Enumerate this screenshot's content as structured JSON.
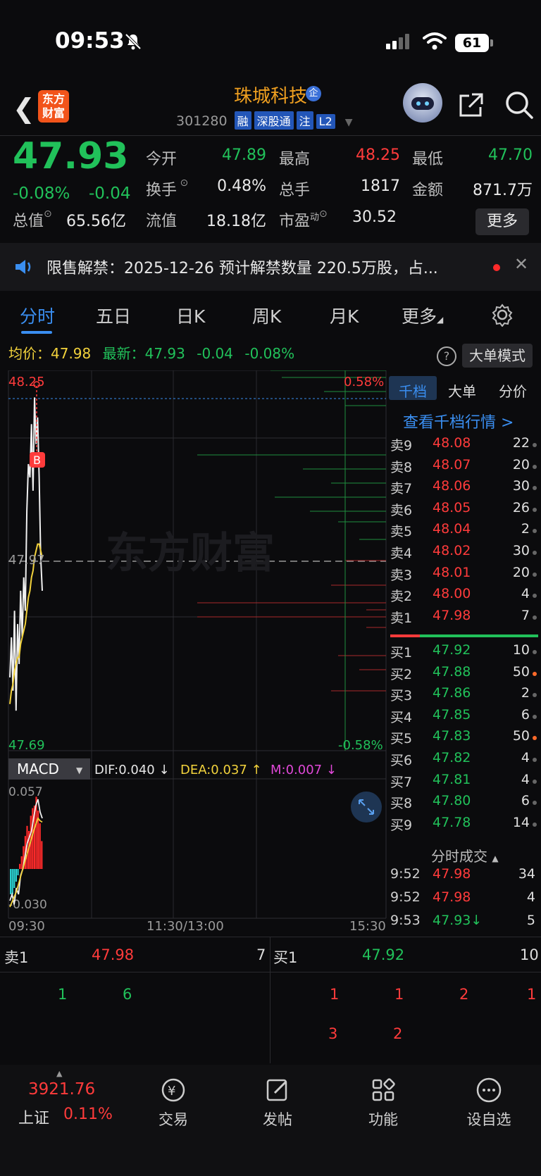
{
  "status_bar": {
    "time": "09:53",
    "battery": "61"
  },
  "header": {
    "logo_line1": "东方",
    "logo_line2": "财富",
    "stock_name": "珠城科技",
    "qi_badge": "企",
    "code": "301280",
    "tags": [
      "融",
      "深股通",
      "注",
      "L2"
    ]
  },
  "quote": {
    "last_price": "47.93",
    "change_pct": "-0.08%",
    "change_abs": "-0.04",
    "open_label": "今开",
    "open": "47.89",
    "high_label": "最高",
    "high": "48.25",
    "low_label": "最低",
    "low": "47.70",
    "turnover_label": "换手",
    "turnover": "0.48%",
    "volume_label": "总手",
    "volume": "1817",
    "amount_label": "金额",
    "amount": "871.7万",
    "mktcap_label": "总值",
    "mktcap": "65.56亿",
    "float_label": "流值",
    "float": "18.18亿",
    "pe_label": "市盈",
    "pe_sup": "动",
    "pe": "30.52",
    "more_label": "更多"
  },
  "notice": {
    "text": "限售解禁：2025-12-26 预计解禁数量 220.5万股，占..."
  },
  "tabs": [
    "分时",
    "五日",
    "日K",
    "周K",
    "月K",
    "更多"
  ],
  "avg_row": {
    "avg_label": "均价：",
    "avg": "47.98",
    "latest_label": "最新：",
    "latest": "47.93",
    "latest_chg": "-0.04",
    "latest_pct": "-0.08%",
    "big_order_label": "大单模式",
    "help": "?"
  },
  "chart_data": {
    "type": "line",
    "y_top_label": "48.25",
    "y_mid_label": "47.97",
    "y_bot_label": "47.69",
    "pct_top_label": "0.58%",
    "pct_bot_label": "-0.58%",
    "x_labels": [
      "09:30",
      "11:30/13:00",
      "15:30"
    ],
    "ylim": [
      47.69,
      48.25
    ],
    "series": [
      {
        "values": [
          47.8,
          47.86,
          47.78,
          47.9,
          47.75,
          47.88,
          47.82,
          47.93,
          47.86,
          47.95,
          47.9,
          48.05,
          48.12,
          48.1,
          48.18,
          48.08,
          48.22,
          48.15,
          48.19,
          48.1,
          47.98,
          47.93
        ],
        "color": "#f0f0f0"
      },
      {
        "values": [
          47.76,
          47.78,
          47.79,
          47.81,
          47.82,
          47.83,
          47.83,
          47.85,
          47.86,
          47.87,
          47.88,
          47.9,
          47.92,
          47.93,
          47.95,
          47.96,
          47.98,
          47.99,
          48.0,
          48.0,
          47.99,
          47.98
        ],
        "color": "#f2d23c"
      }
    ],
    "watermark": "东方财富",
    "marker": "B"
  },
  "macd": {
    "label": "MACD",
    "dif": "DIF:0.040 ↓",
    "dea": "DEA:0.037 ↑",
    "m": "M:0.007 ↓",
    "top": "0.057",
    "bottom": "-0.030",
    "bars": [
      -0.02,
      -0.02,
      -0.015,
      -0.01,
      -0.005,
      0.004,
      0.01,
      0.018,
      0.026,
      0.034,
      0.03,
      0.042,
      0.048,
      0.05,
      0.057,
      0.046,
      0.036,
      0.022
    ],
    "dif_line": [
      -0.025,
      -0.02,
      -0.028,
      -0.015,
      -0.02,
      -0.005,
      0.0,
      0.01,
      0.02,
      0.025,
      0.03,
      0.04,
      0.05,
      0.055,
      0.045,
      0.04
    ],
    "dea_line": [
      -0.03,
      -0.026,
      -0.022,
      -0.018,
      -0.012,
      -0.006,
      0.0,
      0.006,
      0.012,
      0.018,
      0.024,
      0.03,
      0.035,
      0.04,
      0.038,
      0.037
    ]
  },
  "orderbook": {
    "tabs": [
      "千档",
      "大单",
      "分价"
    ],
    "view_link": "查看千档行情 >",
    "asks": [
      {
        "label": "卖9",
        "price": "48.08",
        "vol": "22"
      },
      {
        "label": "卖8",
        "price": "48.07",
        "vol": "20"
      },
      {
        "label": "卖7",
        "price": "48.06",
        "vol": "30"
      },
      {
        "label": "卖6",
        "price": "48.05",
        "vol": "26"
      },
      {
        "label": "卖5",
        "price": "48.04",
        "vol": "2"
      },
      {
        "label": "卖4",
        "price": "48.02",
        "vol": "30"
      },
      {
        "label": "卖3",
        "price": "48.01",
        "vol": "20"
      },
      {
        "label": "卖2",
        "price": "48.00",
        "vol": "4"
      },
      {
        "label": "卖1",
        "price": "47.98",
        "vol": "7"
      }
    ],
    "bids": [
      {
        "label": "买1",
        "price": "47.92",
        "vol": "10",
        "hot": false
      },
      {
        "label": "买2",
        "price": "47.88",
        "vol": "50",
        "hot": true
      },
      {
        "label": "买3",
        "price": "47.86",
        "vol": "2",
        "hot": false
      },
      {
        "label": "买4",
        "price": "47.85",
        "vol": "6",
        "hot": false
      },
      {
        "label": "买5",
        "price": "47.83",
        "vol": "50",
        "hot": true
      },
      {
        "label": "买6",
        "price": "47.82",
        "vol": "4",
        "hot": false
      },
      {
        "label": "买7",
        "price": "47.81",
        "vol": "4",
        "hot": false
      },
      {
        "label": "买8",
        "price": "47.80",
        "vol": "6",
        "hot": false
      },
      {
        "label": "买9",
        "price": "47.78",
        "vol": "14",
        "hot": false
      }
    ],
    "trades_header": "分时成交",
    "trades": [
      {
        "time": "9:52",
        "price": "47.98",
        "vol": "34"
      },
      {
        "time": "9:52",
        "price": "47.98",
        "vol": "4"
      },
      {
        "time": "9:53",
        "price": "47.93↓",
        "vol": "5"
      }
    ]
  },
  "level1": {
    "sell_label": "卖1",
    "sell_price": "47.98",
    "sell_vol": "7",
    "buy_label": "买1",
    "buy_price": "47.92",
    "buy_vol": "10",
    "sell_queue": [
      "1",
      "6"
    ],
    "buy_queue_row1": [
      "1",
      "1",
      "2",
      "1"
    ],
    "buy_queue_row2": [
      "3",
      "2"
    ]
  },
  "bottom_nav": {
    "index_value": "3921.76",
    "index_name": "上证",
    "index_pct": "0.11%",
    "items": [
      "交易",
      "发帖",
      "功能",
      "设自选"
    ]
  }
}
